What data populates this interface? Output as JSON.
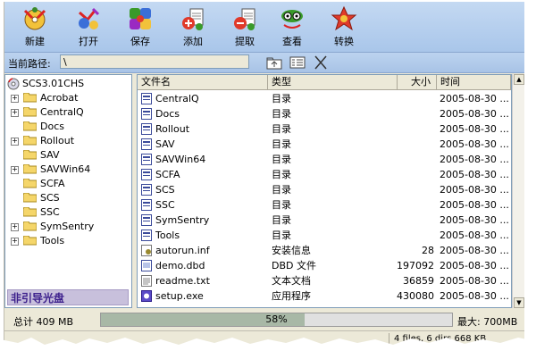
{
  "toolbar": {
    "buttons": [
      {
        "label": "新建",
        "icon": "new-disc-icon"
      },
      {
        "label": "打开",
        "icon": "open-icon"
      },
      {
        "label": "保存",
        "icon": "save-icon"
      },
      {
        "label": "添加",
        "icon": "add-files-icon"
      },
      {
        "label": "提取",
        "icon": "extract-icon"
      },
      {
        "label": "查看",
        "icon": "view-icon"
      },
      {
        "label": "转换",
        "icon": "convert-icon"
      }
    ]
  },
  "pathbar": {
    "label": "当前路径:",
    "value": "\\"
  },
  "tree": {
    "root": "SCS3.01CHS",
    "items": [
      {
        "name": "Acrobat",
        "expandable": true
      },
      {
        "name": "CentralQ",
        "expandable": true
      },
      {
        "name": "Docs",
        "expandable": false
      },
      {
        "name": "Rollout",
        "expandable": true
      },
      {
        "name": "SAV",
        "expandable": false
      },
      {
        "name": "SAVWin64",
        "expandable": true
      },
      {
        "name": "SCFA",
        "expandable": false
      },
      {
        "name": "SCS",
        "expandable": false
      },
      {
        "name": "SSC",
        "expandable": false
      },
      {
        "name": "SymSentry",
        "expandable": true
      },
      {
        "name": "Tools",
        "expandable": true
      }
    ],
    "disc_label": "非引导光盘"
  },
  "list": {
    "columns": [
      "文件名",
      "类型",
      "大小",
      "时间"
    ],
    "rows": [
      {
        "name": "CentralQ",
        "type": "目录",
        "size": "",
        "time": "2005-08-30 ...",
        "kind": "dir"
      },
      {
        "name": "Docs",
        "type": "目录",
        "size": "",
        "time": "2005-08-30 ...",
        "kind": "dir"
      },
      {
        "name": "Rollout",
        "type": "目录",
        "size": "",
        "time": "2005-08-30 ...",
        "kind": "dir"
      },
      {
        "name": "SAV",
        "type": "目录",
        "size": "",
        "time": "2005-08-30 ...",
        "kind": "dir"
      },
      {
        "name": "SAVWin64",
        "type": "目录",
        "size": "",
        "time": "2005-08-30 ...",
        "kind": "dir"
      },
      {
        "name": "SCFA",
        "type": "目录",
        "size": "",
        "time": "2005-08-30 ...",
        "kind": "dir"
      },
      {
        "name": "SCS",
        "type": "目录",
        "size": "",
        "time": "2005-08-30 ...",
        "kind": "dir"
      },
      {
        "name": "SSC",
        "type": "目录",
        "size": "",
        "time": "2005-08-30 ...",
        "kind": "dir"
      },
      {
        "name": "SymSentry",
        "type": "目录",
        "size": "",
        "time": "2005-08-30 ...",
        "kind": "dir"
      },
      {
        "name": "Tools",
        "type": "目录",
        "size": "",
        "time": "2005-08-30 ...",
        "kind": "dir"
      },
      {
        "name": "autorun.inf",
        "type": "安装信息",
        "size": "28",
        "time": "2005-08-30 ...",
        "kind": "inf"
      },
      {
        "name": "demo.dbd",
        "type": "DBD 文件",
        "size": "197092",
        "time": "2005-08-30 ...",
        "kind": "file"
      },
      {
        "name": "readme.txt",
        "type": "文本文档",
        "size": "36859",
        "time": "2005-08-30 ...",
        "kind": "txt"
      },
      {
        "name": "setup.exe",
        "type": "应用程序",
        "size": "430080",
        "time": "2005-08-30 ...",
        "kind": "exe"
      }
    ]
  },
  "status": {
    "total": "总计 409 MB",
    "percent_text": "58%",
    "percent_value": 0.58,
    "max": "最大: 700MB"
  },
  "statusbar": {
    "count": "4 files, 6 dirs 668 KB"
  },
  "colors": {
    "toolbar_bg": "#b3cdee",
    "progress_fill": "#a8b8a6",
    "disc_label_bg": "#c8c0dc",
    "disc_label_text": "#3c1f8c"
  }
}
